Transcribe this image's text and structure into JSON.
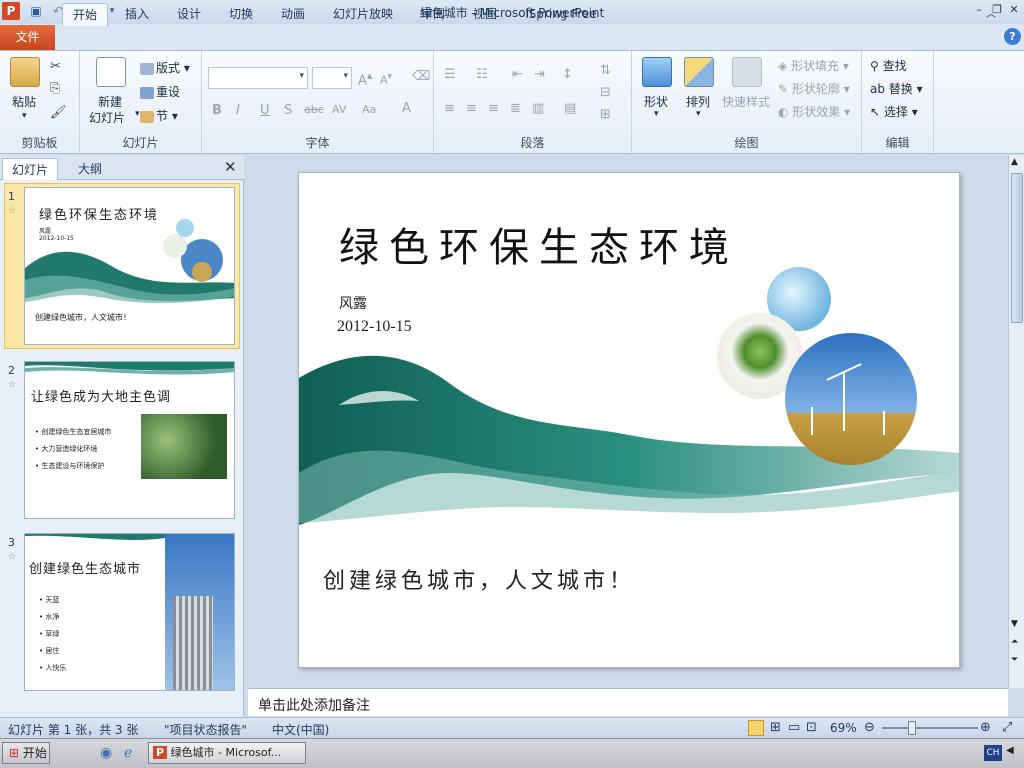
{
  "window": {
    "title": "绿色城市 - Microsoft PowerPoint"
  },
  "tabs": {
    "file": "文件",
    "items": [
      "开始",
      "插入",
      "设计",
      "切换",
      "动画",
      "幻灯片放映",
      "审阅",
      "视图",
      "iSpring Free"
    ]
  },
  "ribbon": {
    "clipboard": {
      "label": "剪贴板",
      "paste": "粘贴"
    },
    "slides": {
      "label": "幻灯片",
      "new_slide_1": "新建",
      "new_slide_2": "幻灯片",
      "layout": "版式",
      "reset": "重设",
      "section": "节"
    },
    "font": {
      "label": "字体",
      "bold": "B",
      "italic": "I",
      "underline": "U",
      "shadow": "S",
      "strike": "abc",
      "spacing": "AV",
      "case": "Aa",
      "color": "A"
    },
    "paragraph": {
      "label": "段落"
    },
    "drawing": {
      "label": "绘图",
      "shapes": "形状",
      "arrange": "排列",
      "quick_styles": "快速样式",
      "fill": "形状填充",
      "outline": "形状轮廓",
      "effects": "形状效果"
    },
    "editing": {
      "label": "编辑",
      "find": "查找",
      "replace": "替换",
      "select": "选择"
    }
  },
  "pane": {
    "tab_slides": "幻灯片",
    "tab_outline": "大纲"
  },
  "thumbnails": [
    {
      "num": "1",
      "title": "绿色环保生态环境",
      "author": "风露",
      "date": "2012-10-15",
      "tagline": "创建绿色城市，人文城市！"
    },
    {
      "num": "2",
      "title": "让绿色成为大地主色调",
      "bullets": [
        "创建绿色生态宜居城市",
        "大力营造绿化环境",
        "生态建设与环境保护"
      ]
    },
    {
      "num": "3",
      "title": "创建绿色生态城市",
      "bullets": [
        "天蓝",
        "水净",
        "草绿",
        "居住",
        "人快乐"
      ]
    }
  ],
  "slide": {
    "title": "绿色环保生态环境",
    "author": "风露",
    "date": "2012-10-15",
    "tagline": "创建绿色城市，人文城市！"
  },
  "notes": {
    "placeholder": "单击此处添加备注"
  },
  "status": {
    "slide_info": "幻灯片 第 1 张，共 3 张",
    "theme": "\"项目状态报告\"",
    "language": "中文(中国)",
    "zoom": "69%"
  },
  "taskbar": {
    "start": "开始",
    "window": "绿色城市 - Microsof...",
    "ime": "CH"
  },
  "colors": {
    "accent": "#2b5797",
    "file_tab": "#d8552b",
    "wave": "#1f7a6b"
  }
}
